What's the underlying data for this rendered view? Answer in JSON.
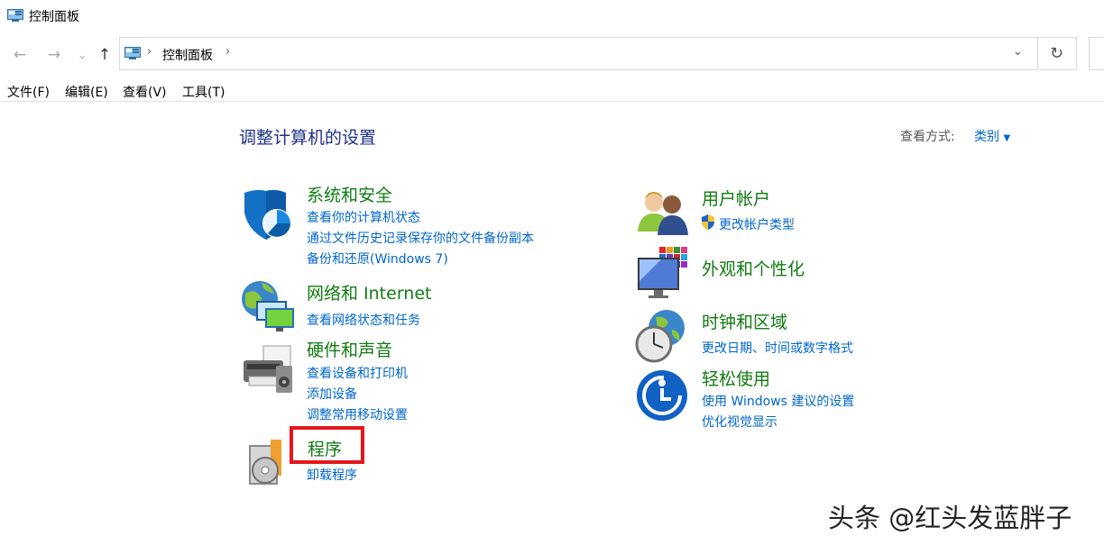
{
  "window": {
    "title": "控制面板"
  },
  "address": {
    "crumb": "控制面板"
  },
  "menu": [
    "文件(F)",
    "编辑(E)",
    "查看(V)",
    "工具(T)"
  ],
  "content": {
    "heading": "调整计算机的设置",
    "view_by_label": "查看方式:",
    "view_by_value": "类别"
  },
  "categories": {
    "system_security": {
      "title": "系统和安全",
      "links": [
        "查看你的计算机状态",
        "通过文件历史记录保存你的文件备份副本",
        "备份和还原(Windows 7)"
      ]
    },
    "network": {
      "title": "网络和 Internet",
      "links": [
        "查看网络状态和任务"
      ]
    },
    "hardware": {
      "title": "硬件和声音",
      "links": [
        "查看设备和打印机",
        "添加设备",
        "调整常用移动设置"
      ]
    },
    "programs": {
      "title": "程序",
      "links": [
        "卸载程序"
      ]
    },
    "user_accounts": {
      "title": "用户帐户",
      "links": [
        "更改帐户类型"
      ]
    },
    "appearance": {
      "title": "外观和个性化",
      "links": []
    },
    "clock_region": {
      "title": "时钟和区域",
      "links": [
        "更改日期、时间或数字格式"
      ]
    },
    "ease_access": {
      "title": "轻松使用",
      "links": [
        "使用 Windows 建议的设置",
        "优化视觉显示"
      ]
    }
  },
  "watermark": "头条 @红头发蓝胖子",
  "colors": {
    "category_title": "#107c10",
    "link": "#0066cc",
    "heading": "#1e3287",
    "highlight": "#e4171c"
  }
}
